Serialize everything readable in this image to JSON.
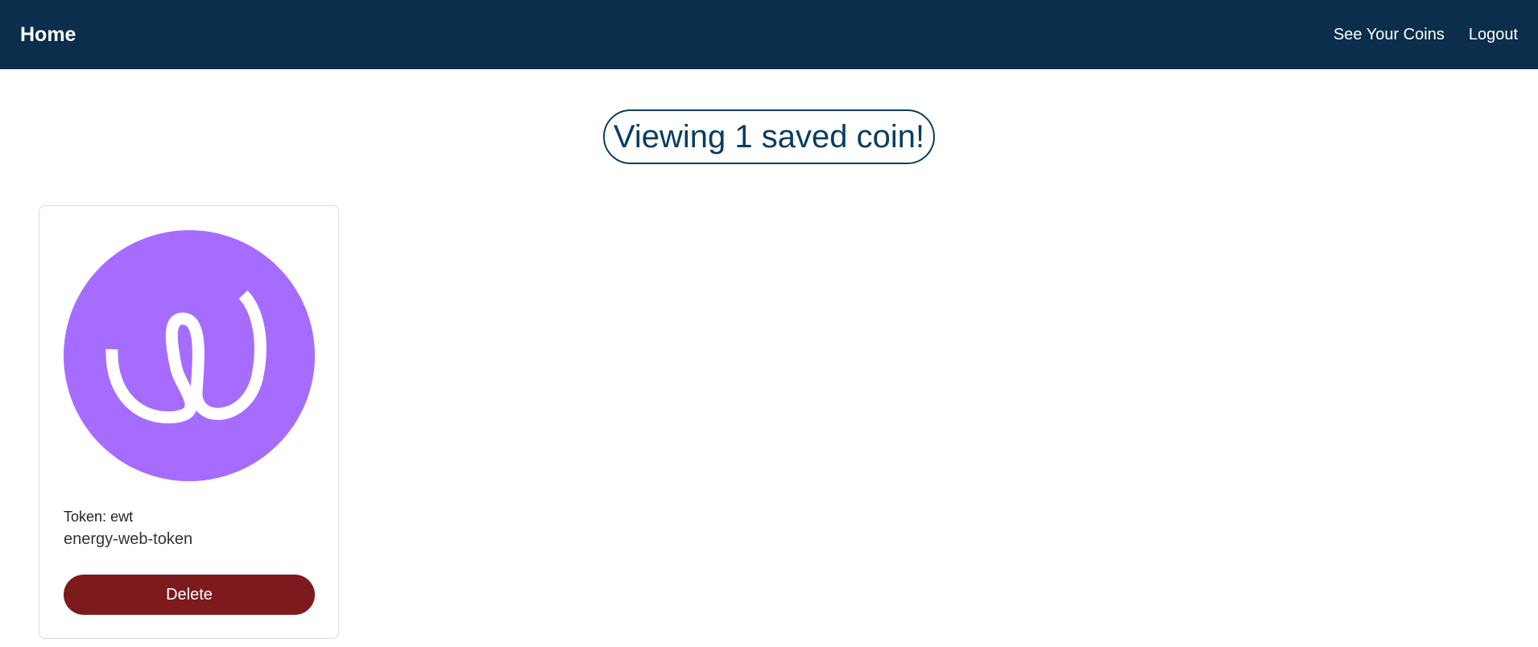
{
  "navbar": {
    "brand": "Home",
    "links": [
      "See Your Coins",
      "Logout"
    ]
  },
  "main": {
    "heading": "Viewing 1 saved coin!"
  },
  "coins": [
    {
      "token_label": "Token:",
      "token": "ewt",
      "id": "energy-web-token",
      "delete_label": "Delete",
      "logo_color": "#a66cff",
      "logo_icon": "energy-web-token-logo"
    }
  ],
  "colors": {
    "navbar_bg": "#0a2e4b",
    "heading_text": "#0a3d62",
    "delete_bg": "#7d1a1d"
  }
}
